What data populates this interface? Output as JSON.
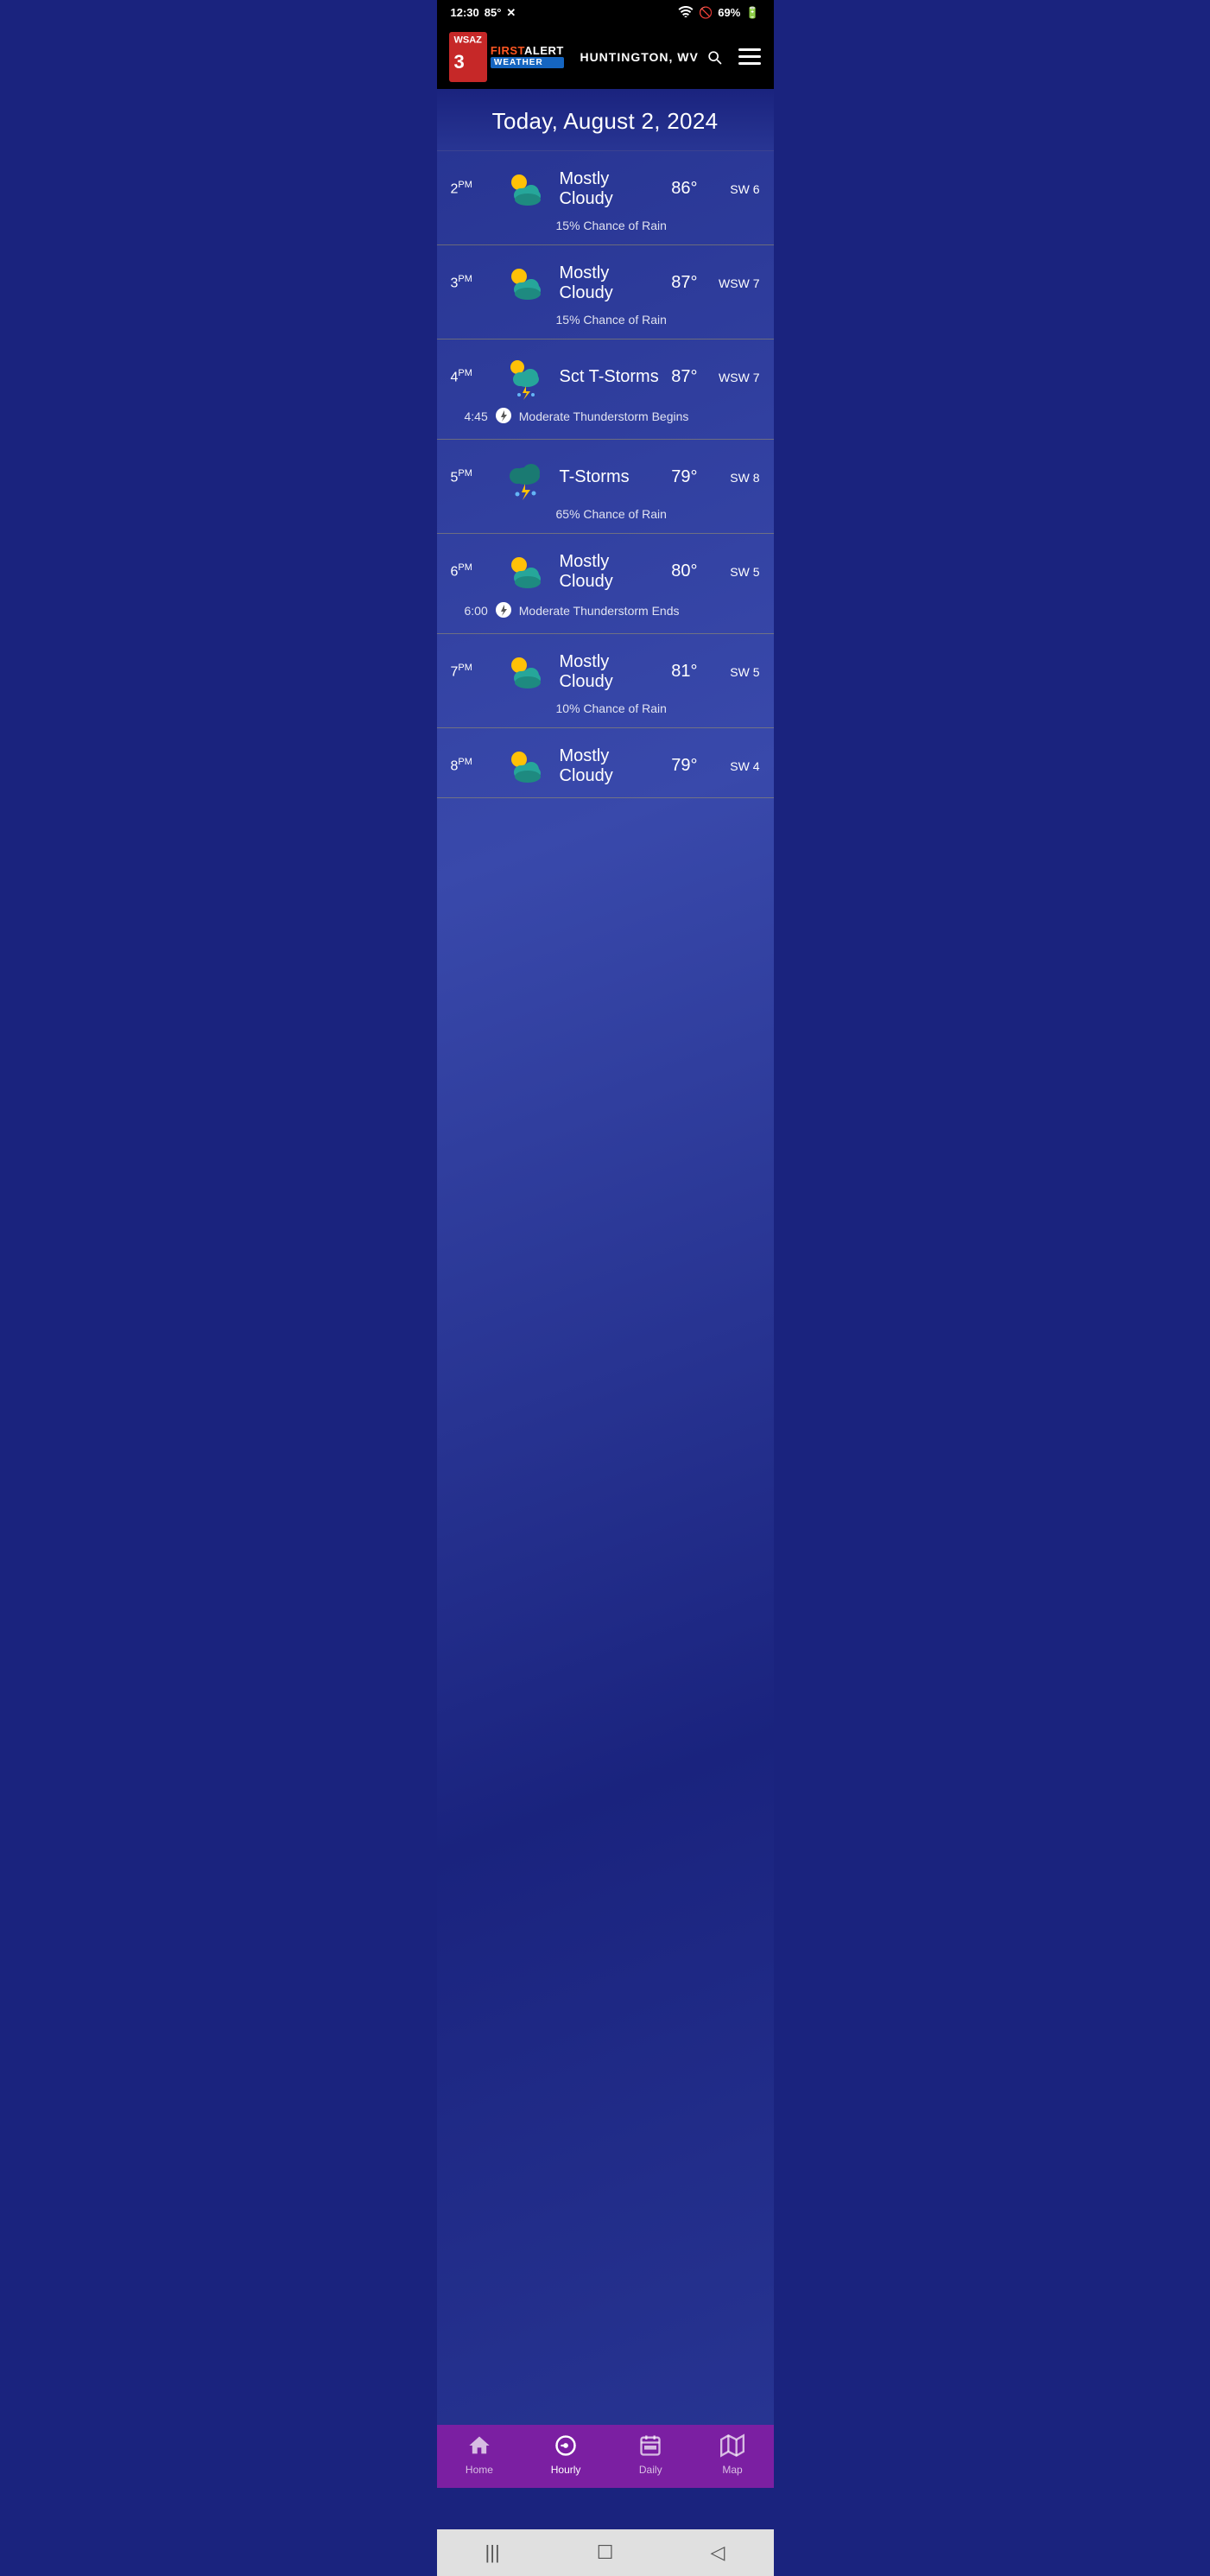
{
  "statusBar": {
    "time": "12:30",
    "temp": "85°",
    "battery": "69%",
    "wifi": true
  },
  "header": {
    "channelNumber": "3",
    "firstLabel": "FIRST",
    "alertLabel": "ALERT",
    "weatherLabel": "WEATHER",
    "location": "HUNTINGTON, WV",
    "menuIcon": "menu-icon",
    "searchIcon": "search-icon"
  },
  "dateBanner": {
    "text": "Today, August 2, 2024"
  },
  "hourlyRows": [
    {
      "hour": "2",
      "period": "PM",
      "condition": "Mostly Cloudy",
      "temp": "86°",
      "wind": "SW 6",
      "iconType": "mostly-cloudy",
      "subText": "15% Chance of Rain",
      "subType": "rain-chance",
      "alertTime": null,
      "alertText": null
    },
    {
      "hour": "3",
      "period": "PM",
      "condition": "Mostly Cloudy",
      "temp": "87°",
      "wind": "WSW 7",
      "iconType": "mostly-cloudy",
      "subText": "15% Chance of Rain",
      "subType": "rain-chance",
      "alertTime": null,
      "alertText": null
    },
    {
      "hour": "4",
      "period": "PM",
      "condition": "Sct T-Storms",
      "temp": "87°",
      "wind": "WSW 7",
      "iconType": "sct-tstorms",
      "subText": null,
      "subType": null,
      "alertTime": "4:45",
      "alertText": "Moderate Thunderstorm Begins"
    },
    {
      "hour": "5",
      "period": "PM",
      "condition": "T-Storms",
      "temp": "79°",
      "wind": "SW 8",
      "iconType": "tstorms",
      "subText": "65% Chance of Rain",
      "subType": "rain-chance",
      "alertTime": null,
      "alertText": null
    },
    {
      "hour": "6",
      "period": "PM",
      "condition": "Mostly Cloudy",
      "temp": "80°",
      "wind": "SW 5",
      "iconType": "mostly-cloudy",
      "subText": null,
      "subType": null,
      "alertTime": "6:00",
      "alertText": "Moderate Thunderstorm Ends"
    },
    {
      "hour": "7",
      "period": "PM",
      "condition": "Mostly Cloudy",
      "temp": "81°",
      "wind": "SW 5",
      "iconType": "mostly-cloudy",
      "subText": "10% Chance of Rain",
      "subType": "rain-chance",
      "alertTime": null,
      "alertText": null
    },
    {
      "hour": "8",
      "period": "PM",
      "condition": "Mostly Cloudy",
      "temp": "79°",
      "wind": "SW 4",
      "iconType": "mostly-cloudy",
      "subText": null,
      "subType": null,
      "alertTime": null,
      "alertText": null
    }
  ],
  "bottomNav": {
    "items": [
      {
        "label": "Home",
        "icon": "home-icon",
        "active": false
      },
      {
        "label": "Hourly",
        "icon": "hourly-icon",
        "active": true
      },
      {
        "label": "Daily",
        "icon": "daily-icon",
        "active": false
      },
      {
        "label": "Map",
        "icon": "map-icon",
        "active": false
      }
    ]
  },
  "systemNav": {
    "back": "◁",
    "home": "☐",
    "recent": "|||"
  }
}
